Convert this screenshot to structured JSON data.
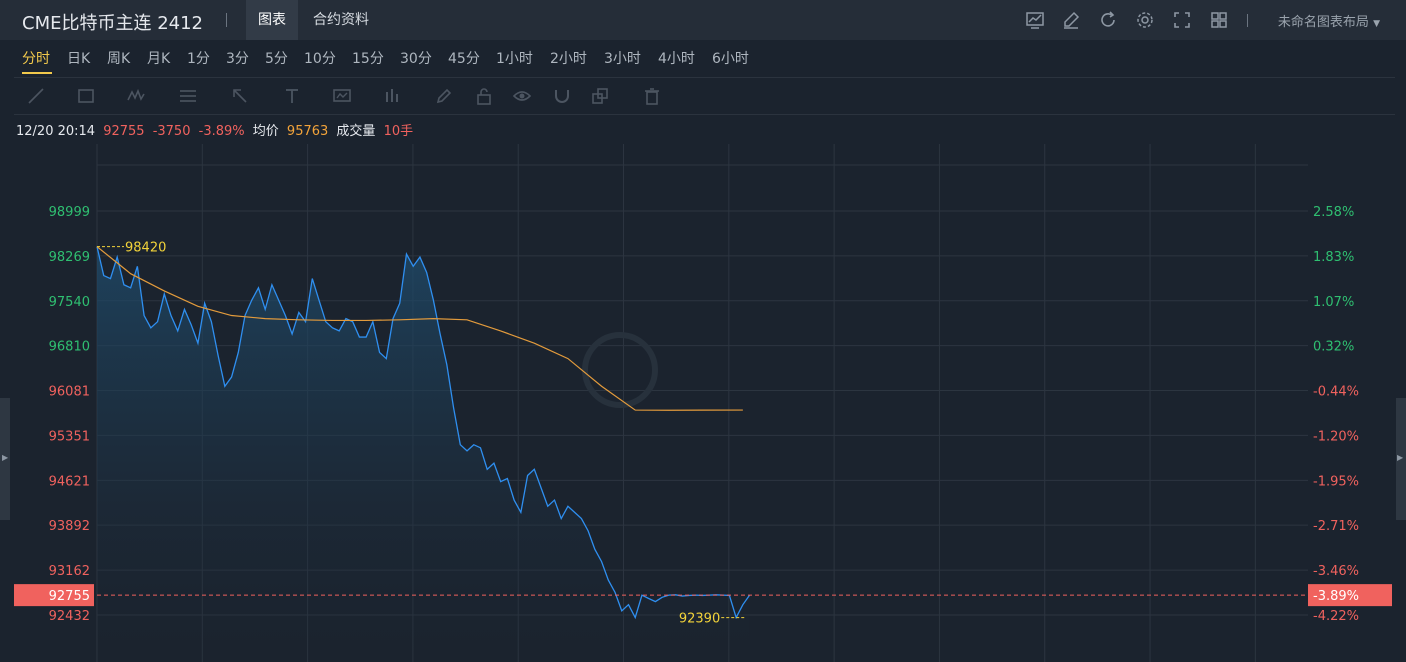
{
  "header": {
    "title": "CME比特币主连 2412",
    "tabs": [
      {
        "label": "图表",
        "active": true
      },
      {
        "label": "合约资料",
        "active": false
      }
    ],
    "tool_icons": [
      "line-chart-icon",
      "edit-icon",
      "refresh-icon",
      "gear-icon",
      "fullscreen-icon",
      "grid-layout-icon"
    ],
    "layout_label": "未命名图表布局"
  },
  "periods": [
    "分时",
    "日K",
    "周K",
    "月K",
    "1分",
    "3分",
    "5分",
    "10分",
    "15分",
    "30分",
    "45分",
    "1小时",
    "2小时",
    "3小时",
    "4小时",
    "6小时"
  ],
  "active_period": "分时",
  "drawing_tools": [
    "line-tool-icon",
    "rectangle-tool-icon",
    "wave-tool-icon",
    "fib-tool-icon",
    "arrow-tool-icon",
    "text-tool-icon",
    "label-tool-icon",
    "bars-tool-icon",
    "pen-tool-icon",
    "lock-icon",
    "eye-icon",
    "magnet-icon",
    "layers-icon",
    "trash-icon"
  ],
  "info": {
    "time": "12/20 20:14",
    "price": "92755",
    "change": "-3750",
    "change_pct": "-3.89%",
    "avg_label": "均价",
    "avg_value": "95763",
    "volume_label": "成交量",
    "volume_value": "10手"
  },
  "colors": {
    "up": "#2fbf71",
    "down": "#f0625e",
    "price_line": "#2f8ff0",
    "avg_line": "#e39b3c",
    "marker": "#f2d33a",
    "grid": "#2c3540"
  },
  "chart_data": {
    "type": "line",
    "ylim": [
      92100,
      99800
    ],
    "prev_close": 96505,
    "current_price": 92755,
    "current_label": "92755",
    "current_pct_label": "-3.89%",
    "high": {
      "value": 98420,
      "label": "98420",
      "x": 0
    },
    "low": {
      "value": 92390,
      "label": "92390",
      "x": 96.5
    },
    "y_ticks": [
      {
        "value": 98999,
        "label": "98999",
        "pct": "2.58%"
      },
      {
        "value": 98269,
        "label": "98269",
        "pct": "1.83%"
      },
      {
        "value": 97540,
        "label": "97540",
        "pct": "1.07%"
      },
      {
        "value": 96810,
        "label": "96810",
        "pct": "0.32%"
      },
      {
        "value": 96081,
        "label": "96081",
        "pct": "-0.44%"
      },
      {
        "value": 95351,
        "label": "95351",
        "pct": "-1.20%"
      },
      {
        "value": 94621,
        "label": "94621",
        "pct": "-1.95%"
      },
      {
        "value": 93892,
        "label": "93892",
        "pct": "-2.71%"
      },
      {
        "value": 93162,
        "label": "93162",
        "pct": "-3.46%"
      },
      {
        "value": 92432,
        "label": "92432",
        "pct": "-4.22%"
      }
    ],
    "x_range": [
      0,
      180
    ],
    "price": {
      "x": [
        0,
        1,
        2,
        3,
        4,
        5,
        6,
        7,
        8,
        9,
        10,
        11,
        12,
        13,
        14,
        15,
        16,
        17,
        18,
        19,
        20,
        21,
        22,
        23,
        24,
        25,
        26,
        27,
        28,
        29,
        30,
        31,
        32,
        33,
        34,
        35,
        36,
        37,
        38,
        39,
        40,
        41,
        42,
        43,
        44,
        45,
        46,
        47,
        48,
        49,
        50,
        51,
        52,
        53,
        54,
        55,
        56,
        57,
        58,
        59,
        60,
        61,
        62,
        63,
        64,
        65,
        66,
        67,
        68,
        69,
        70,
        71,
        72,
        73,
        74,
        75,
        76,
        77,
        78,
        79,
        80,
        81,
        82,
        83,
        84,
        85,
        86,
        87,
        88,
        89,
        90,
        91,
        92,
        93,
        94,
        95,
        96,
        97
      ],
      "y": [
        98420,
        97950,
        97900,
        98250,
        97800,
        97750,
        98100,
        97300,
        97100,
        97200,
        97650,
        97300,
        97050,
        97400,
        97150,
        96850,
        97500,
        97200,
        96650,
        96150,
        96300,
        96700,
        97300,
        97550,
        97750,
        97400,
        97800,
        97550,
        97300,
        97000,
        97350,
        97200,
        97900,
        97550,
        97200,
        97100,
        97050,
        97250,
        97200,
        96950,
        96950,
        97200,
        96700,
        96600,
        97250,
        97500,
        98300,
        98100,
        98250,
        98000,
        97550,
        97000,
        96500,
        95800,
        95200,
        95100,
        95200,
        95150,
        94800,
        94900,
        94600,
        94650,
        94300,
        94100,
        94700,
        94800,
        94500,
        94200,
        94300,
        94000,
        94200,
        94100,
        94000,
        93800,
        93500,
        93300,
        93000,
        92800,
        92500,
        92600,
        92390,
        92755,
        92700,
        92650,
        92720,
        92755,
        92760,
        92740,
        92750,
        92755,
        92750,
        92755,
        92760,
        92755,
        92750,
        92390,
        92600,
        92755
      ]
    },
    "avg": {
      "x": [
        0,
        5,
        10,
        15,
        20,
        25,
        30,
        35,
        40,
        45,
        50,
        55,
        60,
        65,
        70,
        75,
        80,
        85,
        90,
        96
      ],
      "y": [
        98420,
        97980,
        97700,
        97450,
        97300,
        97250,
        97230,
        97220,
        97220,
        97230,
        97250,
        97230,
        97050,
        96850,
        96600,
        96150,
        95763,
        95760,
        95762,
        95763
      ]
    }
  }
}
